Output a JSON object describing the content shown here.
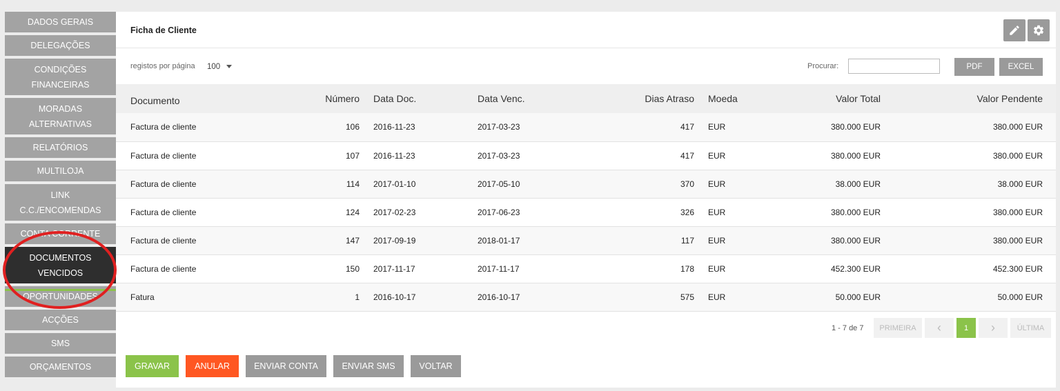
{
  "sidebar": {
    "items": [
      {
        "lines": [
          "DADOS GERAIS"
        ],
        "h": 30
      },
      {
        "lines": [
          "DELEGAÇÕES"
        ],
        "h": 30
      },
      {
        "lines": [
          "CONDIÇÕES",
          "FINANCEIRAS"
        ],
        "h": 53
      },
      {
        "lines": [
          "MORADAS",
          "ALTERNATIVAS"
        ],
        "h": 53
      },
      {
        "lines": [
          "RELATÓRIOS"
        ],
        "h": 30
      },
      {
        "lines": [
          "MULTILOJA"
        ],
        "h": 30
      },
      {
        "lines": [
          "LINK",
          "C.C./ENCOMENDAS"
        ],
        "h": 53
      },
      {
        "lines": [
          "CONTA CORRENTE"
        ],
        "h": 30
      },
      {
        "lines": [
          "DOCUMENTOS",
          "VENCIDOS"
        ],
        "h": 53,
        "active": true
      },
      {
        "lines": [
          "OPORTUNIDADES"
        ],
        "h": 30
      },
      {
        "lines": [
          "ACÇÕES"
        ],
        "h": 30
      },
      {
        "lines": [
          "SMS"
        ],
        "h": 30
      },
      {
        "lines": [
          "ORÇAMENTOS"
        ],
        "h": 30
      }
    ]
  },
  "panel": {
    "title": "Ficha de Cliente",
    "edit_icon": "pencil-icon",
    "settings_icon": "gear-icon"
  },
  "toolbar": {
    "per_page_label": "registos por página",
    "per_page_value": "100",
    "search_label": "Procurar:",
    "search_value": "",
    "pdf_label": "PDF",
    "excel_label": "EXCEL"
  },
  "table": {
    "headers": [
      "Documento",
      "Número",
      "Data Doc.",
      "Data Venc.",
      "Dias Atraso",
      "Moeda",
      "Valor Total",
      "Valor Pendente"
    ],
    "rows": [
      [
        "Factura de cliente",
        "106",
        "2016-11-23",
        "2017-03-23",
        "417",
        "EUR",
        "380.000 EUR",
        "380.000 EUR"
      ],
      [
        "Factura de cliente",
        "107",
        "2016-11-23",
        "2017-03-23",
        "417",
        "EUR",
        "380.000 EUR",
        "380.000 EUR"
      ],
      [
        "Factura de cliente",
        "114",
        "2017-01-10",
        "2017-05-10",
        "370",
        "EUR",
        "38.000 EUR",
        "38.000 EUR"
      ],
      [
        "Factura de cliente",
        "124",
        "2017-02-23",
        "2017-06-23",
        "326",
        "EUR",
        "380.000 EUR",
        "380.000 EUR"
      ],
      [
        "Factura de cliente",
        "147",
        "2017-09-19",
        "2018-01-17",
        "117",
        "EUR",
        "380.000 EUR",
        "380.000 EUR"
      ],
      [
        "Factura de cliente",
        "150",
        "2017-11-17",
        "2017-11-17",
        "178",
        "EUR",
        "452.300 EUR",
        "452.300 EUR"
      ],
      [
        "Fatura",
        "1",
        "2016-10-17",
        "2016-10-17",
        "575",
        "EUR",
        "50.000 EUR",
        "50.000 EUR"
      ]
    ]
  },
  "pagination": {
    "info": "1 - 7 de 7",
    "first": "PRIMEIRA",
    "prev": "‹",
    "current": "1",
    "next": "›",
    "last": "ÚLTIMA"
  },
  "actions": {
    "save": "GRAVAR",
    "cancel": "ANULAR",
    "send_account": "ENVIAR CONTA",
    "send_sms": "ENVIAR SMS",
    "back": "VOLTAR"
  },
  "colors": {
    "green": "#8bc34a",
    "orange": "#ff5722",
    "grey_button": "#9a9a9a",
    "sidebar_active": "#2e2e2e",
    "annotation_red": "#e02020"
  }
}
